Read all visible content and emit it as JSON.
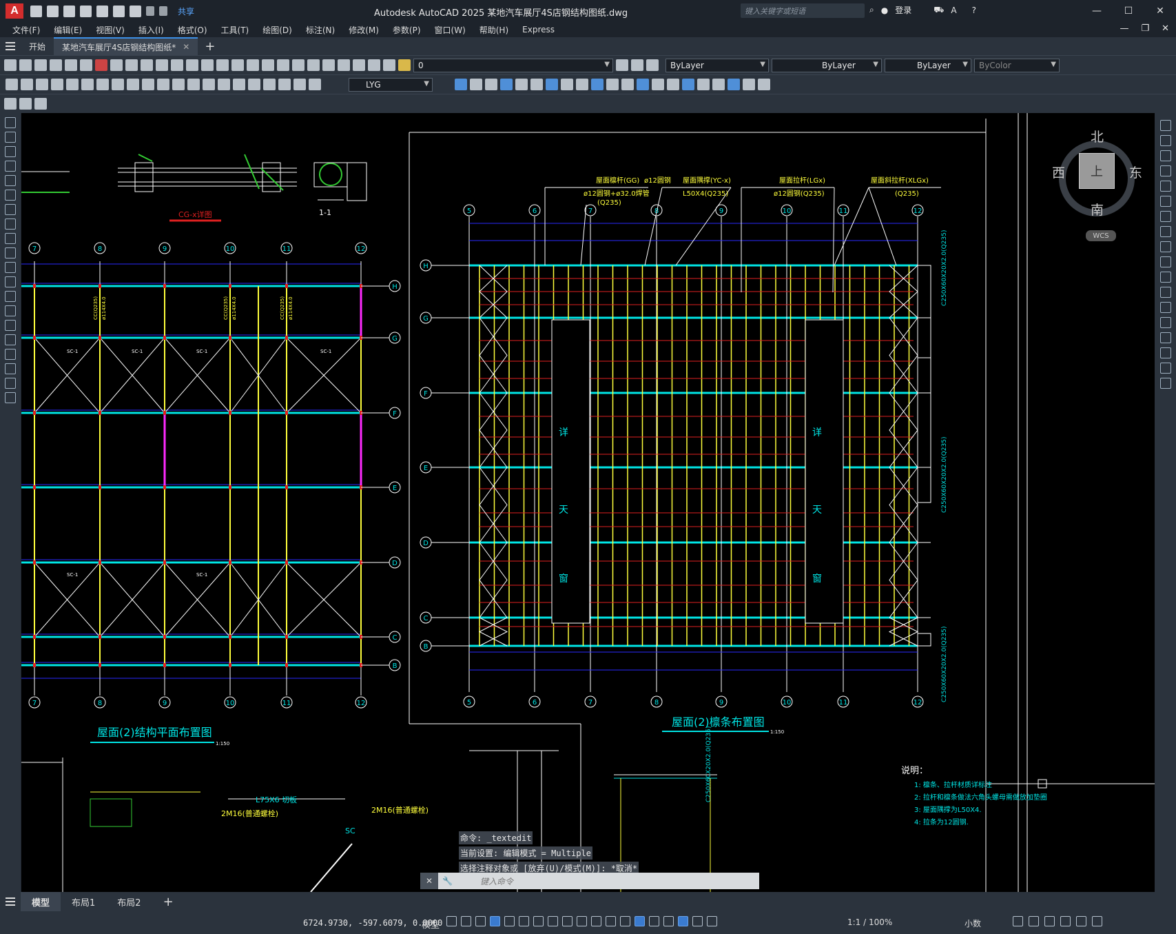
{
  "app": {
    "logo": "A",
    "window_title": "Autodesk AutoCAD 2025    某地汽车展厅4S店钢结构图纸.dwg",
    "share_label": "共享",
    "search_placeholder": "键入关键字或短语",
    "login_label": "登录"
  },
  "menu": {
    "items": [
      "文件(F)",
      "编辑(E)",
      "视图(V)",
      "插入(I)",
      "格式(O)",
      "工具(T)",
      "绘图(D)",
      "标注(N)",
      "修改(M)",
      "参数(P)",
      "窗口(W)",
      "帮助(H)",
      "Express"
    ]
  },
  "tabs": {
    "start": "开始",
    "file": "某地汽车展厅4S店钢结构图纸*"
  },
  "properties": {
    "layer_value": "0",
    "color": "ByLayer",
    "linetype": "ByLayer",
    "lineweight": "ByLayer",
    "plotstyle": "ByColor",
    "textstyle": "LYG"
  },
  "viewcube": {
    "north": "北",
    "south": "南",
    "east": "东",
    "west": "西",
    "top": "上",
    "wcs": "WCS"
  },
  "drawing": {
    "left_title": "屋面(2)结构平面布置图",
    "left_scale": "1:150",
    "right_title": "屋面(2)檩条布置图",
    "right_scale": "1:150",
    "detail_title": "CG-x详图",
    "section_label": "1-1",
    "grid_bottom_left": [
      "7",
      "8",
      "9",
      "10",
      "11",
      "12"
    ],
    "grid_right_left": [
      "H",
      "G",
      "F",
      "E",
      "D",
      "C",
      "B"
    ],
    "grid_top_right": [
      "5",
      "6",
      "7",
      "8",
      "9",
      "10",
      "11",
      "12"
    ],
    "grid_right_side": [
      "H",
      "G",
      "F",
      "E",
      "D",
      "C",
      "B"
    ],
    "skylight": [
      "详",
      "天",
      "窗"
    ],
    "ann_gg_title": "屋面檩杆(GG)",
    "ann_gg_spec": "ø12圆钢+ø32.0焊管",
    "ann_gg_mat": "(Q235)",
    "ann_round": "ø12圆钢",
    "ann_yc_title": "屋面隅撑(YC-x)",
    "ann_yc_spec": "L50X4(Q235)",
    "ann_lg_title": "屋面拉杆(LGx)",
    "ann_lg_spec": "ø12圆钢(Q235)",
    "ann_xlg_title": "屋面斜拉杆(XLGx)",
    "ann_xlg_mat": "(Q235)",
    "purlin_spec": "C250X60X20X2.0(Q235)",
    "notes_title": "说明：",
    "notes": [
      "1: 檩条、拉杆材质详标注",
      "2: 拉杆和檩条做法六角头螺母需做放加垫圈",
      "3: 屋面隅撑为L50X4.",
      "4: 拉条为12圆钢."
    ],
    "detail_labels": [
      "L75X6 切板",
      "2M16(普通螺栓)",
      "2M16(普通螺栓)",
      "SC"
    ],
    "brace_label": "SC-1",
    "col_label": "CC(Q235)",
    "col_spec": "ø114X4.0"
  },
  "command": {
    "history": [
      "命令: _textedit",
      "当前设置: 编辑模式 = Multiple",
      "选择注释对象或 [放弃(U)/模式(M)]: *取消*"
    ],
    "placeholder": "键入命令"
  },
  "layouts": {
    "items": [
      "模型",
      "布局1",
      "布局2"
    ]
  },
  "status": {
    "coordinates": "6724.9730, -597.6079, 0.0000",
    "space": "模型",
    "scale": "1:1 / 100%",
    "units": "小数"
  },
  "colors": {
    "accent": "#3c8fe6",
    "cad_cyan": "#00e5e5",
    "cad_yellow": "#ffff3c",
    "cad_red": "#e02020",
    "cad_magenta": "#ff2bff",
    "cad_blue": "#2a2aff"
  }
}
